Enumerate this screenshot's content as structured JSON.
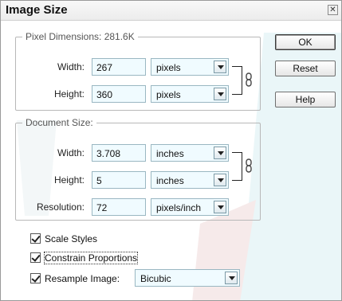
{
  "window": {
    "title": "Image Size",
    "close_glyph": "✕"
  },
  "pixel_dimensions": {
    "legend": "Pixel Dimensions:  281.6K",
    "width_label": "Width:",
    "width_value": "267",
    "width_unit": "pixels",
    "height_label": "Height:",
    "height_value": "360",
    "height_unit": "pixels"
  },
  "document_size": {
    "legend": "Document Size:",
    "width_label": "Width:",
    "width_value": "3.708",
    "width_unit": "inches",
    "height_label": "Height:",
    "height_value": "5",
    "height_unit": "inches",
    "resolution_label": "Resolution:",
    "resolution_value": "72",
    "resolution_unit": "pixels/inch"
  },
  "options": {
    "scale_styles": {
      "label": "Scale Styles",
      "checked": true
    },
    "constrain_proportions": {
      "label": "Constrain Proportions",
      "checked": true
    },
    "resample_image": {
      "label": "Resample Image:",
      "checked": true,
      "method": "Bicubic"
    }
  },
  "buttons": {
    "ok": "OK",
    "reset": "Reset",
    "help": "Help"
  },
  "icons": {
    "close": "close-icon",
    "link": "chain-link-icon",
    "dropdown": "chevron-down-icon",
    "check": "checkmark-icon"
  }
}
